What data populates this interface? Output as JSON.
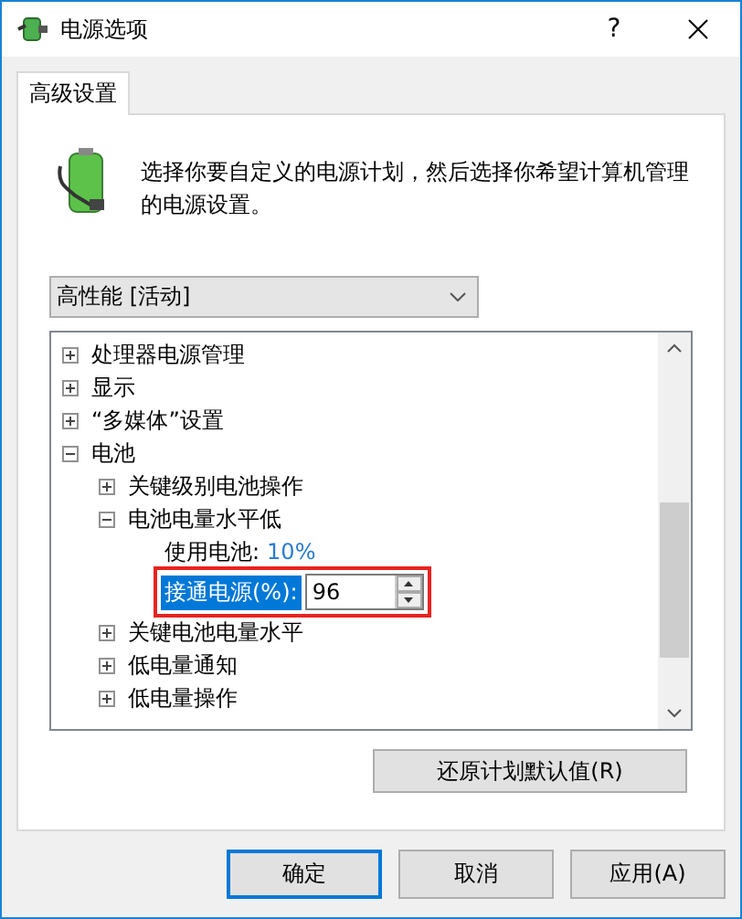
{
  "window": {
    "title": "电源选项",
    "help": "?"
  },
  "tabs": [
    {
      "label": "高级设置",
      "selected": true
    }
  ],
  "description": "选择你要自定义的电源计划，然后选择你希望计算机管理的电源设置。",
  "plan_dropdown": {
    "value": "高性能 [活动]"
  },
  "tree": [
    {
      "label": "处理器电源管理",
      "expanded": false
    },
    {
      "label": "显示",
      "expanded": false
    },
    {
      "label": "“多媒体”设置",
      "expanded": false
    },
    {
      "label": "电池",
      "expanded": true,
      "children": [
        {
          "label": "关键级别电池操作",
          "expanded": false
        },
        {
          "label": "电池电量水平低",
          "expanded": true,
          "children": [
            {
              "kind": "value",
              "label": "使用电池:",
              "value": "10%"
            },
            {
              "kind": "edit",
              "label": "接通电源(%):",
              "value": "96",
              "selected": true
            }
          ]
        },
        {
          "label": "关键电池电量水平",
          "expanded": false
        },
        {
          "label": "低电量通知",
          "expanded": false
        },
        {
          "label": "低电量操作",
          "expanded": false
        }
      ]
    }
  ],
  "restore_button": "还原计划默认值(R)",
  "buttons": [
    {
      "label": "确定",
      "default": true
    },
    {
      "label": "取消",
      "default": false
    },
    {
      "label": "应用(A)",
      "default": false
    }
  ]
}
